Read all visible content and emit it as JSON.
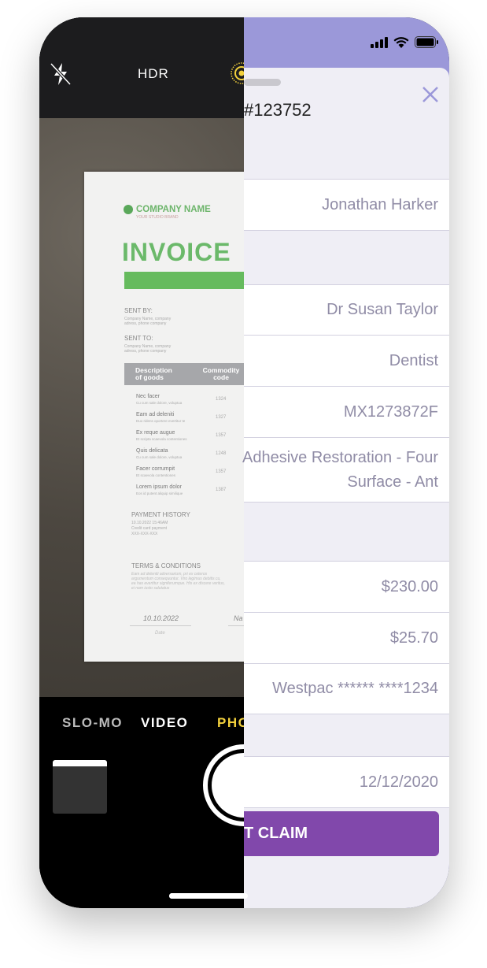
{
  "camera": {
    "hdr": "HDR",
    "modes": [
      "SLO-MO",
      "VIDEO",
      "PHO"
    ],
    "active_color": "#f2d03c"
  },
  "invoice": {
    "company": "COMPANY NAME",
    "brand": "YOUR STUDIO BRAND",
    "title": "INVOICE",
    "sent_by": "SENT BY:",
    "sent_by_text": "Company Name, company adress, phone company",
    "sent_to": "SENT TO:",
    "sent_to_text": "Company Name, company adress, phone company",
    "col1": "Description of goods",
    "col2": "Commodity code",
    "items": [
      {
        "name": "Nec facer",
        "sub": "Cu cum sale dolore, voluptua",
        "code": "1324"
      },
      {
        "name": "Eam ad deleniti",
        "sub": "Duo ridens oportere evertitur te",
        "code": "1327"
      },
      {
        "name": "Ex reque augue",
        "sub": "Et scripta scaevola contentiones",
        "code": "1357"
      },
      {
        "name": "Quis delicata",
        "sub": "Cu cum sale dolore, voluptua",
        "code": "1248"
      },
      {
        "name": "Facer corrumpit",
        "sub": "Et scaevola contentiones",
        "code": "1357"
      },
      {
        "name": "Lorem ipsum dolor",
        "sub": "Eos id putent aliquip similique",
        "code": "1387"
      }
    ],
    "payment_history": "PAYMENT HISTORY",
    "payment_lines": [
      "10.10.2022 15:46AM",
      "Credit card payment",
      "XXX-XXX-XXX"
    ],
    "terms": "TERMS & CONDITIONS",
    "terms_text": "Eam ad deleniti adversarium, pri ex ceteros argumentum consequuntur. Viro legimus debitis cu, ea has evertitur signiferumque. His ex discere veritus, ei nam iusto salutatus",
    "date": "10.10.2022",
    "date_label": "Date",
    "name_partial": "Na"
  },
  "form": {
    "title": "#123752",
    "fields": [
      "Jonathan Harker",
      "Dr Susan Taylor",
      "Dentist",
      "MX1273872F",
      "Adhesive Restoration - Four Surface - Ant",
      "$230.00",
      "$25.70",
      "Westpac ****** ****1234",
      "12/12/2020"
    ],
    "submit": "T CLAIM",
    "accent": "#8148ab",
    "header_color": "#9b98d9"
  }
}
